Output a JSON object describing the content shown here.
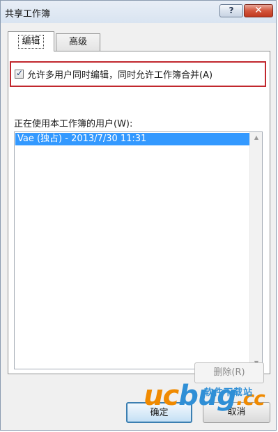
{
  "window": {
    "title": "共享工作簿",
    "help_label": "?",
    "close_label": "✕"
  },
  "tabs": [
    {
      "label": "编辑",
      "active": true
    },
    {
      "label": "高级",
      "active": false
    }
  ],
  "edit_tab": {
    "allow_multiuser_label": "允许多用户同时编辑，同时允许工作簿合并(A)",
    "allow_multiuser_checked": true,
    "users_label": "正在使用本工作簿的用户(W):",
    "users": [
      "Vae (独占) - 2013/7/30 11:31"
    ],
    "remove_button": "删除(R)"
  },
  "footer": {
    "ok_label": "确定",
    "cancel_label": "取消"
  },
  "watermark": {
    "uc": "uc",
    "bug": "bug",
    "cc": ".cc",
    "sub": "软件下载站"
  },
  "colors": {
    "highlight_border": "#c1272d",
    "selection": "#3399ff",
    "close_button": "#c0381f"
  }
}
